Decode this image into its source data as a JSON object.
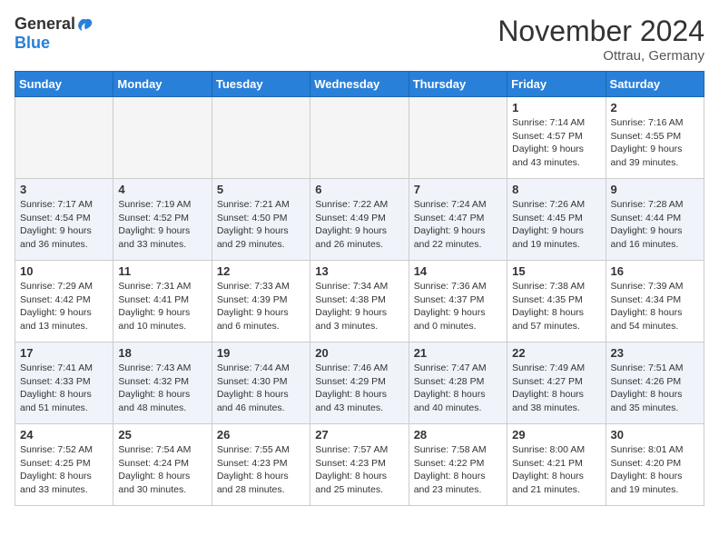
{
  "header": {
    "logo_general": "General",
    "logo_blue": "Blue",
    "month_title": "November 2024",
    "location": "Ottrau, Germany"
  },
  "columns": [
    "Sunday",
    "Monday",
    "Tuesday",
    "Wednesday",
    "Thursday",
    "Friday",
    "Saturday"
  ],
  "weeks": [
    {
      "row_class": "row-odd",
      "days": [
        {
          "num": "",
          "info": "",
          "empty": true
        },
        {
          "num": "",
          "info": "",
          "empty": true
        },
        {
          "num": "",
          "info": "",
          "empty": true
        },
        {
          "num": "",
          "info": "",
          "empty": true
        },
        {
          "num": "",
          "info": "",
          "empty": true
        },
        {
          "num": "1",
          "info": "Sunrise: 7:14 AM\nSunset: 4:57 PM\nDaylight: 9 hours\nand 43 minutes.",
          "empty": false
        },
        {
          "num": "2",
          "info": "Sunrise: 7:16 AM\nSunset: 4:55 PM\nDaylight: 9 hours\nand 39 minutes.",
          "empty": false
        }
      ]
    },
    {
      "row_class": "row-even",
      "days": [
        {
          "num": "3",
          "info": "Sunrise: 7:17 AM\nSunset: 4:54 PM\nDaylight: 9 hours\nand 36 minutes.",
          "empty": false
        },
        {
          "num": "4",
          "info": "Sunrise: 7:19 AM\nSunset: 4:52 PM\nDaylight: 9 hours\nand 33 minutes.",
          "empty": false
        },
        {
          "num": "5",
          "info": "Sunrise: 7:21 AM\nSunset: 4:50 PM\nDaylight: 9 hours\nand 29 minutes.",
          "empty": false
        },
        {
          "num": "6",
          "info": "Sunrise: 7:22 AM\nSunset: 4:49 PM\nDaylight: 9 hours\nand 26 minutes.",
          "empty": false
        },
        {
          "num": "7",
          "info": "Sunrise: 7:24 AM\nSunset: 4:47 PM\nDaylight: 9 hours\nand 22 minutes.",
          "empty": false
        },
        {
          "num": "8",
          "info": "Sunrise: 7:26 AM\nSunset: 4:45 PM\nDaylight: 9 hours\nand 19 minutes.",
          "empty": false
        },
        {
          "num": "9",
          "info": "Sunrise: 7:28 AM\nSunset: 4:44 PM\nDaylight: 9 hours\nand 16 minutes.",
          "empty": false
        }
      ]
    },
    {
      "row_class": "row-odd",
      "days": [
        {
          "num": "10",
          "info": "Sunrise: 7:29 AM\nSunset: 4:42 PM\nDaylight: 9 hours\nand 13 minutes.",
          "empty": false
        },
        {
          "num": "11",
          "info": "Sunrise: 7:31 AM\nSunset: 4:41 PM\nDaylight: 9 hours\nand 10 minutes.",
          "empty": false
        },
        {
          "num": "12",
          "info": "Sunrise: 7:33 AM\nSunset: 4:39 PM\nDaylight: 9 hours\nand 6 minutes.",
          "empty": false
        },
        {
          "num": "13",
          "info": "Sunrise: 7:34 AM\nSunset: 4:38 PM\nDaylight: 9 hours\nand 3 minutes.",
          "empty": false
        },
        {
          "num": "14",
          "info": "Sunrise: 7:36 AM\nSunset: 4:37 PM\nDaylight: 9 hours\nand 0 minutes.",
          "empty": false
        },
        {
          "num": "15",
          "info": "Sunrise: 7:38 AM\nSunset: 4:35 PM\nDaylight: 8 hours\nand 57 minutes.",
          "empty": false
        },
        {
          "num": "16",
          "info": "Sunrise: 7:39 AM\nSunset: 4:34 PM\nDaylight: 8 hours\nand 54 minutes.",
          "empty": false
        }
      ]
    },
    {
      "row_class": "row-even",
      "days": [
        {
          "num": "17",
          "info": "Sunrise: 7:41 AM\nSunset: 4:33 PM\nDaylight: 8 hours\nand 51 minutes.",
          "empty": false
        },
        {
          "num": "18",
          "info": "Sunrise: 7:43 AM\nSunset: 4:32 PM\nDaylight: 8 hours\nand 48 minutes.",
          "empty": false
        },
        {
          "num": "19",
          "info": "Sunrise: 7:44 AM\nSunset: 4:30 PM\nDaylight: 8 hours\nand 46 minutes.",
          "empty": false
        },
        {
          "num": "20",
          "info": "Sunrise: 7:46 AM\nSunset: 4:29 PM\nDaylight: 8 hours\nand 43 minutes.",
          "empty": false
        },
        {
          "num": "21",
          "info": "Sunrise: 7:47 AM\nSunset: 4:28 PM\nDaylight: 8 hours\nand 40 minutes.",
          "empty": false
        },
        {
          "num": "22",
          "info": "Sunrise: 7:49 AM\nSunset: 4:27 PM\nDaylight: 8 hours\nand 38 minutes.",
          "empty": false
        },
        {
          "num": "23",
          "info": "Sunrise: 7:51 AM\nSunset: 4:26 PM\nDaylight: 8 hours\nand 35 minutes.",
          "empty": false
        }
      ]
    },
    {
      "row_class": "row-odd",
      "days": [
        {
          "num": "24",
          "info": "Sunrise: 7:52 AM\nSunset: 4:25 PM\nDaylight: 8 hours\nand 33 minutes.",
          "empty": false
        },
        {
          "num": "25",
          "info": "Sunrise: 7:54 AM\nSunset: 4:24 PM\nDaylight: 8 hours\nand 30 minutes.",
          "empty": false
        },
        {
          "num": "26",
          "info": "Sunrise: 7:55 AM\nSunset: 4:23 PM\nDaylight: 8 hours\nand 28 minutes.",
          "empty": false
        },
        {
          "num": "27",
          "info": "Sunrise: 7:57 AM\nSunset: 4:23 PM\nDaylight: 8 hours\nand 25 minutes.",
          "empty": false
        },
        {
          "num": "28",
          "info": "Sunrise: 7:58 AM\nSunset: 4:22 PM\nDaylight: 8 hours\nand 23 minutes.",
          "empty": false
        },
        {
          "num": "29",
          "info": "Sunrise: 8:00 AM\nSunset: 4:21 PM\nDaylight: 8 hours\nand 21 minutes.",
          "empty": false
        },
        {
          "num": "30",
          "info": "Sunrise: 8:01 AM\nSunset: 4:20 PM\nDaylight: 8 hours\nand 19 minutes.",
          "empty": false
        }
      ]
    }
  ]
}
